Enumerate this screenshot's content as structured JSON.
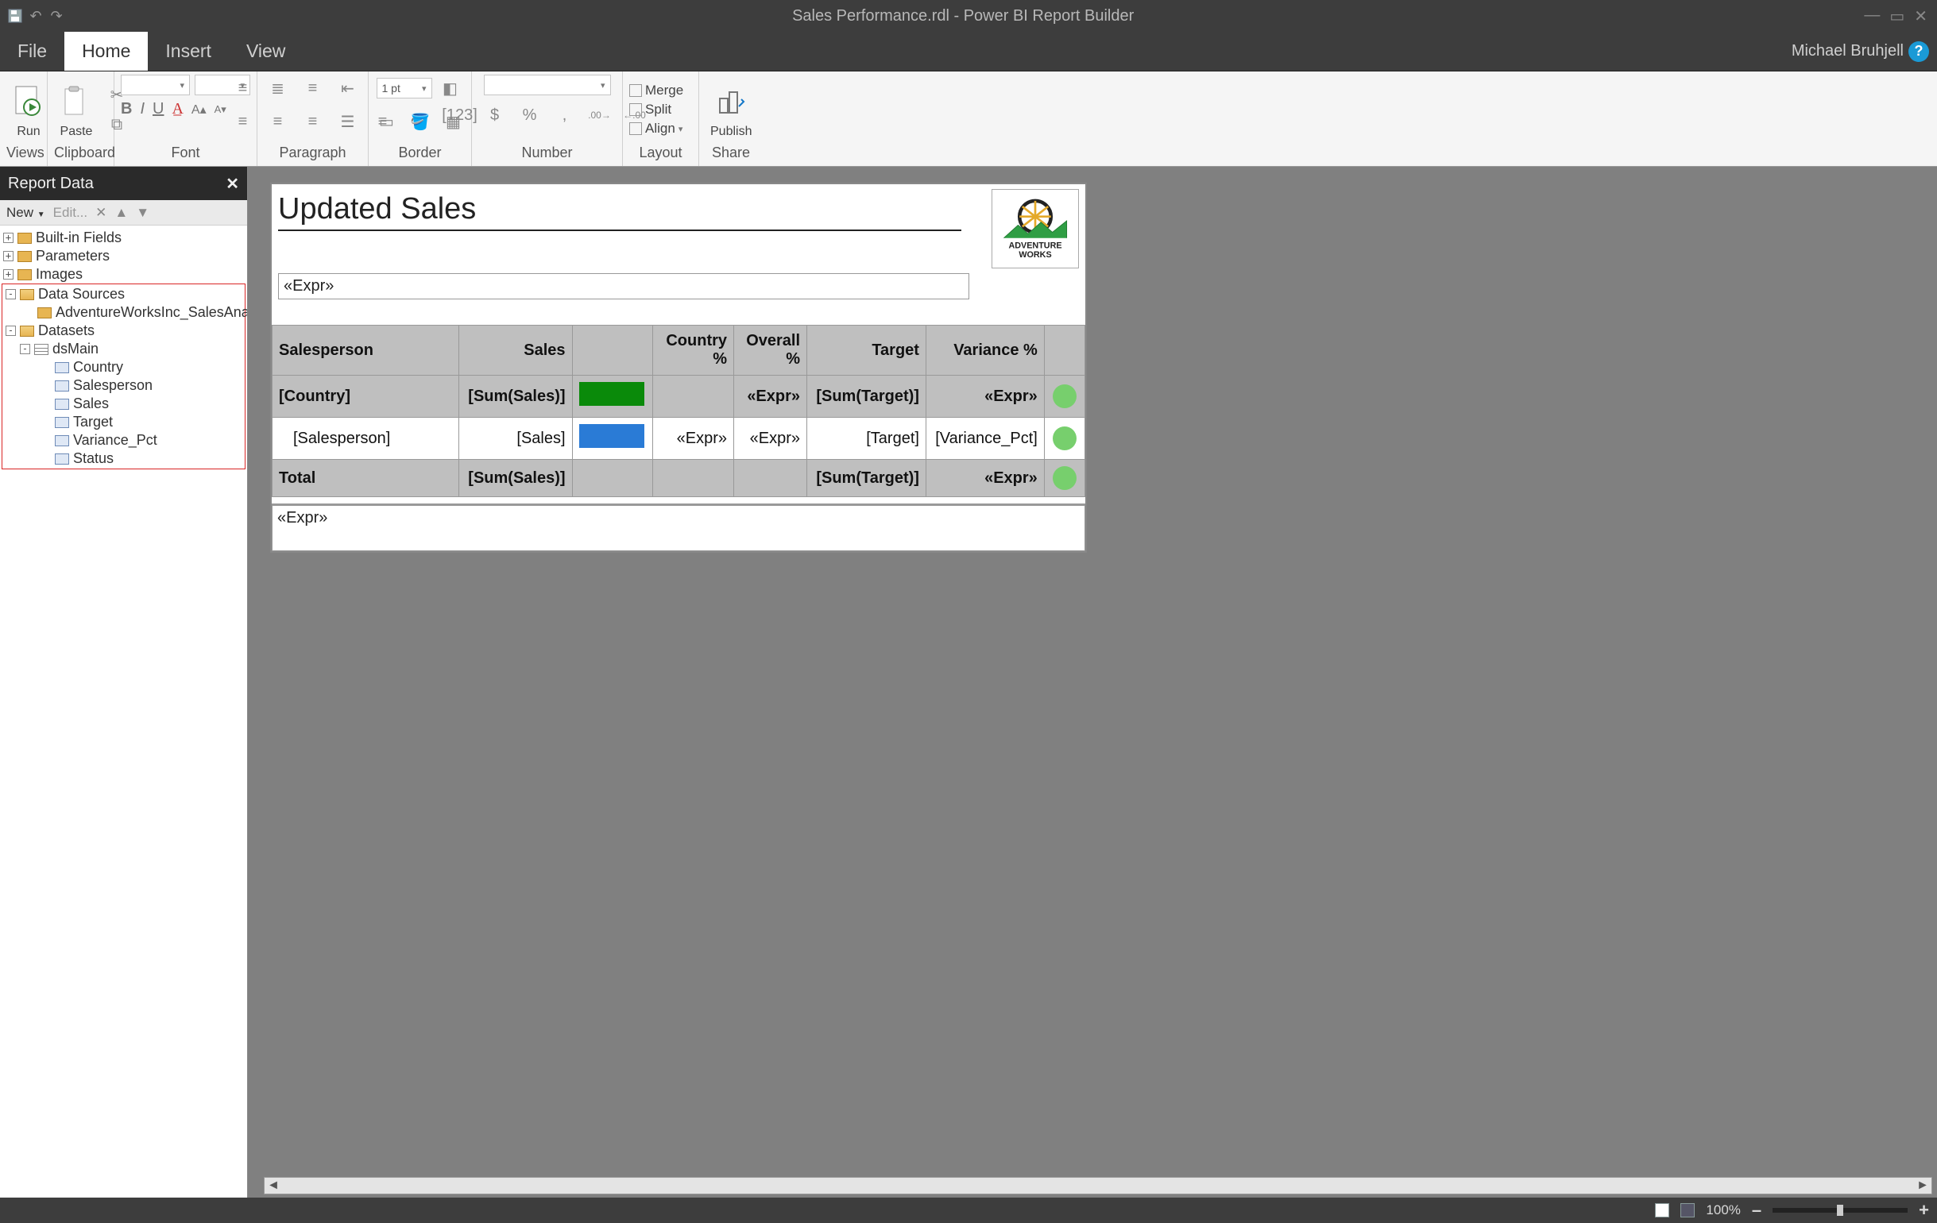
{
  "titlebar": {
    "title": "Sales Performance.rdl - Power BI Report Builder"
  },
  "tabs": {
    "file": "File",
    "home": "Home",
    "insert": "Insert",
    "view": "View"
  },
  "user": {
    "name": "Michael Bruhjell"
  },
  "ribbon": {
    "run": "Run",
    "paste": "Paste",
    "publish": "Publish",
    "merge": "Merge",
    "split": "Split",
    "align": "Align",
    "groups": {
      "views": "Views",
      "clipboard": "Clipboard",
      "font": "Font",
      "paragraph": "Paragraph",
      "border": "Border",
      "number": "Number",
      "layout": "Layout",
      "share": "Share"
    },
    "border_width": "1 pt"
  },
  "reportdata": {
    "title": "Report Data",
    "new": "New",
    "edit": "Edit...",
    "nodes": {
      "builtin": "Built-in Fields",
      "parameters": "Parameters",
      "images": "Images",
      "datasources": "Data Sources",
      "ds1": "AdventureWorksInc_SalesAnalysis",
      "datasets": "Datasets",
      "dsMain": "dsMain",
      "fields": [
        "Country",
        "Salesperson",
        "Sales",
        "Target",
        "Variance_Pct",
        "Status"
      ]
    }
  },
  "report": {
    "title": "Updated Sales",
    "expr": "«Expr»",
    "logo_top": "ADVENTURE",
    "logo_bot": "WORKS",
    "columns": [
      "Salesperson",
      "Sales",
      "",
      "Country %",
      "Overall %",
      "Target",
      "Variance %",
      ""
    ],
    "row_country": {
      "c0": "[Country]",
      "c1": "[Sum(Sales)]",
      "c4": "«Expr»",
      "c5": "[Sum(Target)]",
      "c6": "«Expr»"
    },
    "row_sp": {
      "c0": "[Salesperson]",
      "c1": "[Sales]",
      "c3": "«Expr»",
      "c4": "«Expr»",
      "c5": "[Target]",
      "c6": "[Variance_Pct]"
    },
    "row_total": {
      "c0": "Total",
      "c1": "[Sum(Sales)]",
      "c5": "[Sum(Target)]",
      "c6": "«Expr»"
    },
    "footer": "«Expr»"
  },
  "status": {
    "zoom": "100%"
  }
}
